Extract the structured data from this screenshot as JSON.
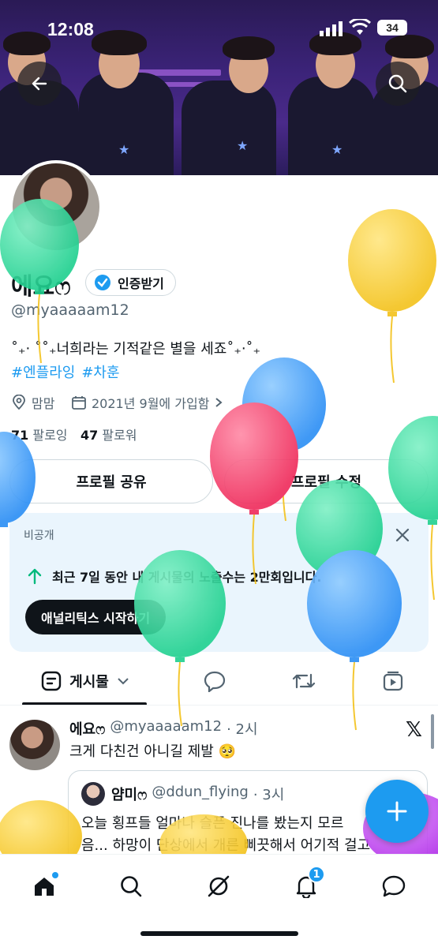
{
  "status_bar": {
    "time": "12:08",
    "battery": "34"
  },
  "profile": {
    "name": "에요ෆ",
    "verify_label": "인증받기",
    "handle": "@myaaaaam12",
    "bio": "˚₊‧ ˚˚₊너희라는 기적같은 별을 세죠˚₊‧˚₊",
    "hashtags": [
      "#엔플라잉",
      "#차훈"
    ],
    "location": "맘맘",
    "joined": "2021년 9월에 가입함",
    "following_count": "71",
    "following_label": "팔로잉",
    "followers_count": "47",
    "followers_label": "팔로워",
    "share_button": "프로필 공유",
    "edit_button": "프로필 수정"
  },
  "private_card": {
    "label": "비공개",
    "message_prefix": "최근 7일 동안 내 게시물의 노출수는 ",
    "message_value": "2만회입니다.",
    "button": "애널리틱스 시작하기"
  },
  "tabs": {
    "posts_label": "게시물"
  },
  "tweet": {
    "name": "에요ෆ",
    "handle": "@myaaaaam12",
    "time": "· 2시",
    "text": "크게 다친건 아니길 제발 🥺",
    "quote": {
      "name": "얌미ෆ",
      "handle": "@ddun_flying",
      "time": "· 3시",
      "line1": "오늘 횡프들 얼마나 슬픈 진나를 봤는지 모르",
      "line2": "음... 하망이 단상에서 개른 삐끗해서 어기적 걸고"
    }
  },
  "nav": {
    "notification_badge": "1"
  },
  "colors": {
    "accent": "#1d9bf0",
    "banner": "#3b2378",
    "card": "#eaf5fd"
  }
}
